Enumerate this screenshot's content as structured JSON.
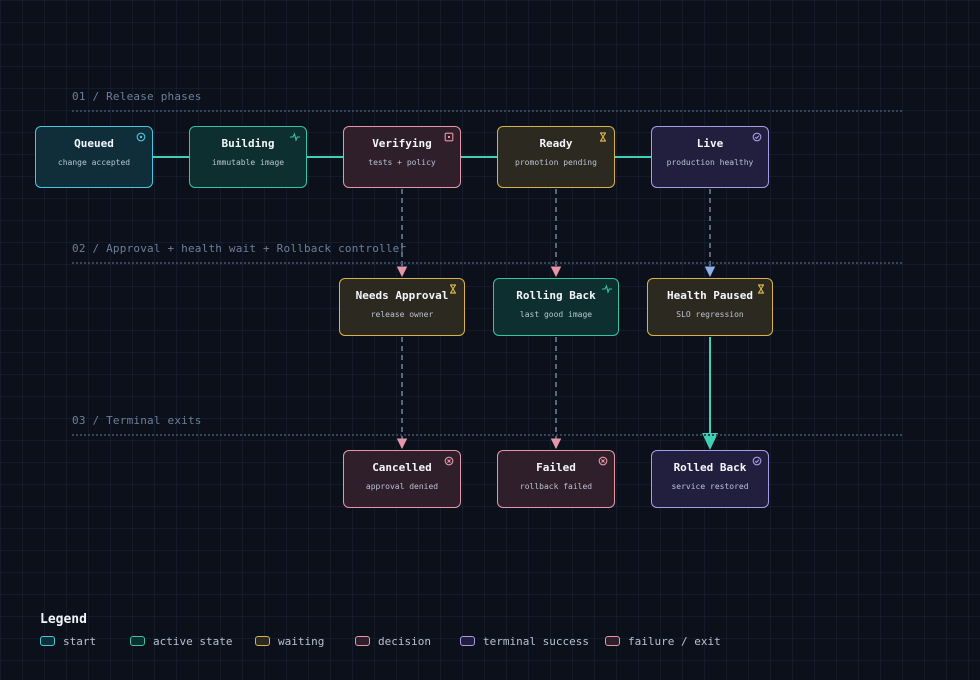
{
  "lanes": [
    {
      "label": "01 / Release phases"
    },
    {
      "label": "02 / Approval + health wait + Rollback controller"
    },
    {
      "label": "03 / Terminal exits"
    }
  ],
  "nodes": [
    {
      "id": "queued",
      "title": "Queued",
      "subtitle": "change accepted",
      "type": "start",
      "icon": "target-icon"
    },
    {
      "id": "building",
      "title": "Building",
      "subtitle": "immutable image",
      "type": "active",
      "icon": "pulse-icon"
    },
    {
      "id": "verifying",
      "title": "Verifying",
      "subtitle": "tests + policy",
      "type": "decision",
      "icon": "square-dot-icon"
    },
    {
      "id": "ready",
      "title": "Ready",
      "subtitle": "promotion pending",
      "type": "wait",
      "icon": "hourglass-icon"
    },
    {
      "id": "live",
      "title": "Live",
      "subtitle": "production healthy",
      "type": "success",
      "icon": "check-circle-icon"
    },
    {
      "id": "needs-approval",
      "title": "Needs Approval",
      "subtitle": "release owner",
      "type": "wait",
      "icon": "hourglass-icon"
    },
    {
      "id": "rolling-back",
      "title": "Rolling Back",
      "subtitle": "last good image",
      "type": "active",
      "icon": "pulse-icon"
    },
    {
      "id": "health-paused",
      "title": "Health Paused",
      "subtitle": "SLO regression",
      "type": "wait",
      "icon": "hourglass-icon"
    },
    {
      "id": "cancelled",
      "title": "Cancelled",
      "subtitle": "approval denied",
      "type": "fail",
      "icon": "x-circle-icon"
    },
    {
      "id": "failed",
      "title": "Failed",
      "subtitle": "rollback failed",
      "type": "fail",
      "icon": "x-circle-icon"
    },
    {
      "id": "rolled-back",
      "title": "Rolled Back",
      "subtitle": "service restored",
      "type": "success",
      "icon": "check-circle-icon"
    }
  ],
  "legend": {
    "title": "Legend",
    "items": [
      {
        "label": "start",
        "type": "start"
      },
      {
        "label": "active state",
        "type": "active"
      },
      {
        "label": "waiting",
        "type": "wait"
      },
      {
        "label": "decision",
        "type": "decision"
      },
      {
        "label": "terminal success",
        "type": "success"
      },
      {
        "label": "failure / exit",
        "type": "fail"
      }
    ]
  },
  "colors": {
    "background": "#0b101b",
    "start": "#4cc6dc",
    "active": "#36c3a6",
    "wait": "#d8b34a",
    "decision": "#e796a8",
    "success": "#a99ae6",
    "fail": "#e796a8",
    "connector_solid": "#3ed1b4",
    "connector_dashed": "#6f859e"
  }
}
